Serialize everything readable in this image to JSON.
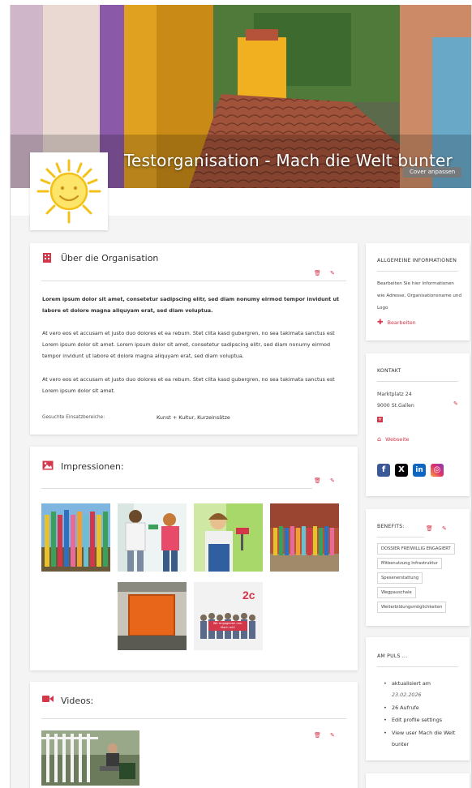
{
  "cover": {
    "title": "Testorganisation - Mach die Welt bunter",
    "edit_cover_label": "Cover anpassen"
  },
  "about": {
    "title": "Über die Organisation",
    "para1": "Lorem ipsum dolor sit amet, consetetur sadipscing elitr, sed diam nonumy eirmod tempor invidunt ut labore et dolore magna aliquyam erat, sed diam voluptua.",
    "para2": "At vero eos et accusam et justo duo dolores et ea rebum. Stet clita kasd gubergren, no sea takimata sanctus est Lorem ipsum dolor sit amet. Lorem ipsum dolor sit amet, consetetur sadipscing elitr, sed diam nonumy eirmod tempor invidunt ut labore et dolore magna aliquyam erat, sed diam voluptua.",
    "para3": "At vero eos et accusam et justo duo dolores et ea rebum. Stet clita kasd gubergren, no sea takimata sanctus est Lorem ipsum dolor sit amet.",
    "areas_label": "Gesuchte Einsatzbereiche:",
    "areas_value": "Kunst + Kultur, Kurzeinsätze"
  },
  "impressions": {
    "title": "Impressionen:",
    "poster_text": "Wir engagieren uns. Mach mit!",
    "poster_number": "2c"
  },
  "videos": {
    "title": "Videos:"
  },
  "general": {
    "title": "ALLGEMEINE INFORMATIONEN",
    "text": "Bearbeiten Sie hier Informationen wie Adresse, Organisationsname und Logo",
    "edit_label": "Bearbeiten"
  },
  "contact": {
    "title": "KONTAKT",
    "street": "Marktplatz 24",
    "city": "9000 St.Gallen",
    "website_label": "Webseite",
    "social": [
      "facebook-icon",
      "x-icon",
      "linkedin-icon",
      "instagram-icon"
    ]
  },
  "benefits": {
    "title": "BENEFITS:",
    "tags": [
      "DOSSIER FREIWILLIG ENGAGIERT",
      "Mitbenutzung Infrastruktur",
      "Spesenerstattung",
      "Wegpauschale",
      "Weiterbildungsmöglichkeiten"
    ]
  },
  "pulse": {
    "title": "AM PULS ...",
    "updated_label": "aktualisiert am",
    "updated_date": "23.02.2026",
    "views": "26 Aufrufe",
    "edit_profile": "Edit profile settings",
    "view_user": "View user Mach die Welt bunter"
  },
  "colors": {
    "accent": "#d4364a",
    "facebook": "#3b5998",
    "x": "#000000",
    "linkedin": "#0a66c2",
    "instagram": "#c13584"
  }
}
